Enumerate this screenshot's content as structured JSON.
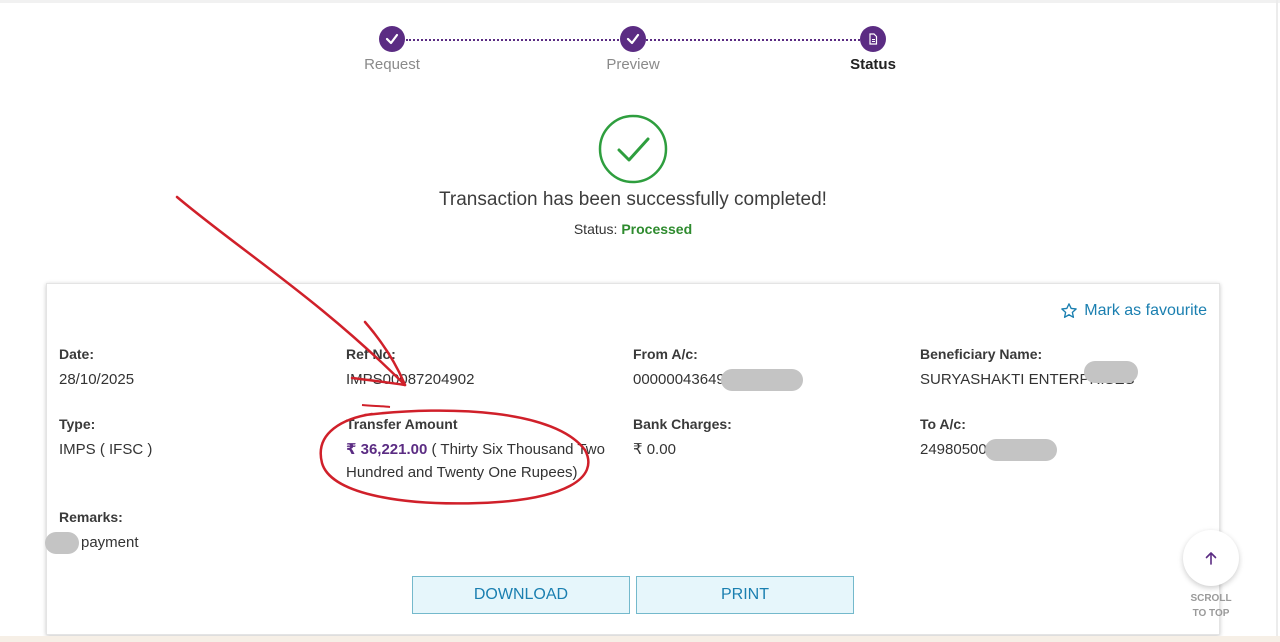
{
  "stepper": {
    "steps": [
      {
        "label": "Request",
        "state": "done"
      },
      {
        "label": "Preview",
        "state": "done"
      },
      {
        "label": "Status",
        "state": "active"
      }
    ]
  },
  "result": {
    "message": "Transaction has been successfully completed!",
    "status_label": "Status:",
    "status_value": "Processed",
    "status_color": "#2e8b2e"
  },
  "card": {
    "favourite_label": "Mark as favourite",
    "date": {
      "label": "Date:",
      "value": "28/10/2025"
    },
    "ref_no": {
      "label": "Ref No:",
      "value": "IMPS00087204902"
    },
    "from_ac": {
      "label": "From A/c:",
      "value": "00000043649"
    },
    "beneficiary": {
      "label": "Beneficiary Name:",
      "value": "SURYASHAKTI ENTERPRISES"
    },
    "type": {
      "label": "Type:",
      "value": "IMPS ( IFSC )"
    },
    "transfer_amount": {
      "label": "Transfer Amount",
      "amount": "₹ 36,221.00",
      "words": "( Thirty Six Thousand Two Hundred and Twenty One Rupees)"
    },
    "bank_charges": {
      "label": "Bank Charges:",
      "value": "₹ 0.00"
    },
    "to_ac": {
      "label": "To A/c:",
      "value": "24980500"
    },
    "remarks": {
      "label": "Remarks:",
      "value": "payment"
    },
    "download_label": "DOWNLOAD",
    "print_label": "PRINT"
  },
  "scroll_top": {
    "line1": "SCROLL",
    "line2": "TO TOP"
  },
  "theme": {
    "accent": "#5b2c83",
    "link": "#1a7fb0",
    "success": "#2e9e3e",
    "annotation": "#d0202a"
  }
}
